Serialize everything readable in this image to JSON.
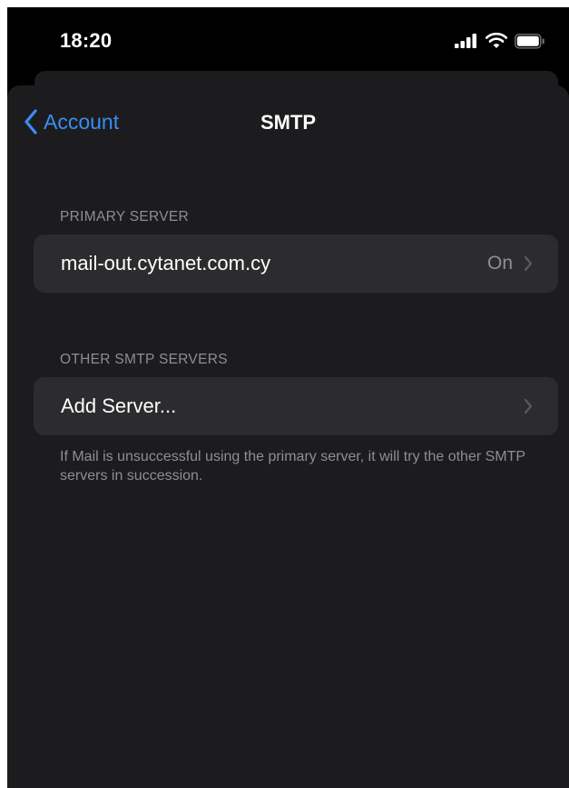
{
  "status_bar": {
    "time": "18:20",
    "icons": [
      "cellular-signal-icon",
      "wifi-icon",
      "battery-icon"
    ]
  },
  "nav": {
    "back_label": "Account",
    "title": "SMTP"
  },
  "primary_section": {
    "header": "PRIMARY SERVER",
    "server": {
      "label": "mail-out.cytanet.com.cy",
      "value": "On"
    }
  },
  "other_section": {
    "header": "OTHER SMTP SERVERS",
    "add_server_label": "Add Server...",
    "footer": "If Mail is unsuccessful using the primary server, it will try the other SMTP servers in succession."
  },
  "colors": {
    "accent": "#3a8df5",
    "background": "#1c1c1e",
    "cell": "#2c2c2e",
    "secondary_text": "#8e8e93"
  }
}
